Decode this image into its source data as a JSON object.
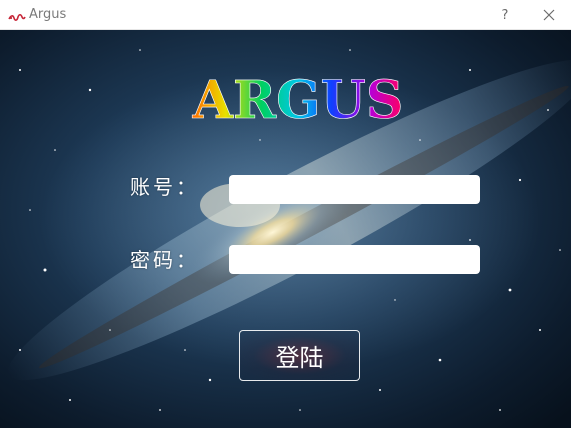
{
  "window": {
    "title": "Argus",
    "help_label": "?",
    "close_icon": "close-icon",
    "app_icon": "argus-app-icon"
  },
  "logo": {
    "text": "ARGUS",
    "colors": [
      "#ff6a00",
      "#e0e000",
      "#00d060",
      "#00c8e8",
      "#1040ff",
      "#b000e0",
      "#ff0060"
    ]
  },
  "form": {
    "account_label": "账号：",
    "account_value": "",
    "password_label": "密码：",
    "password_value": "",
    "login_button": "登陆"
  },
  "background": {
    "theme": "galaxy",
    "base_color": "#0b1826"
  }
}
